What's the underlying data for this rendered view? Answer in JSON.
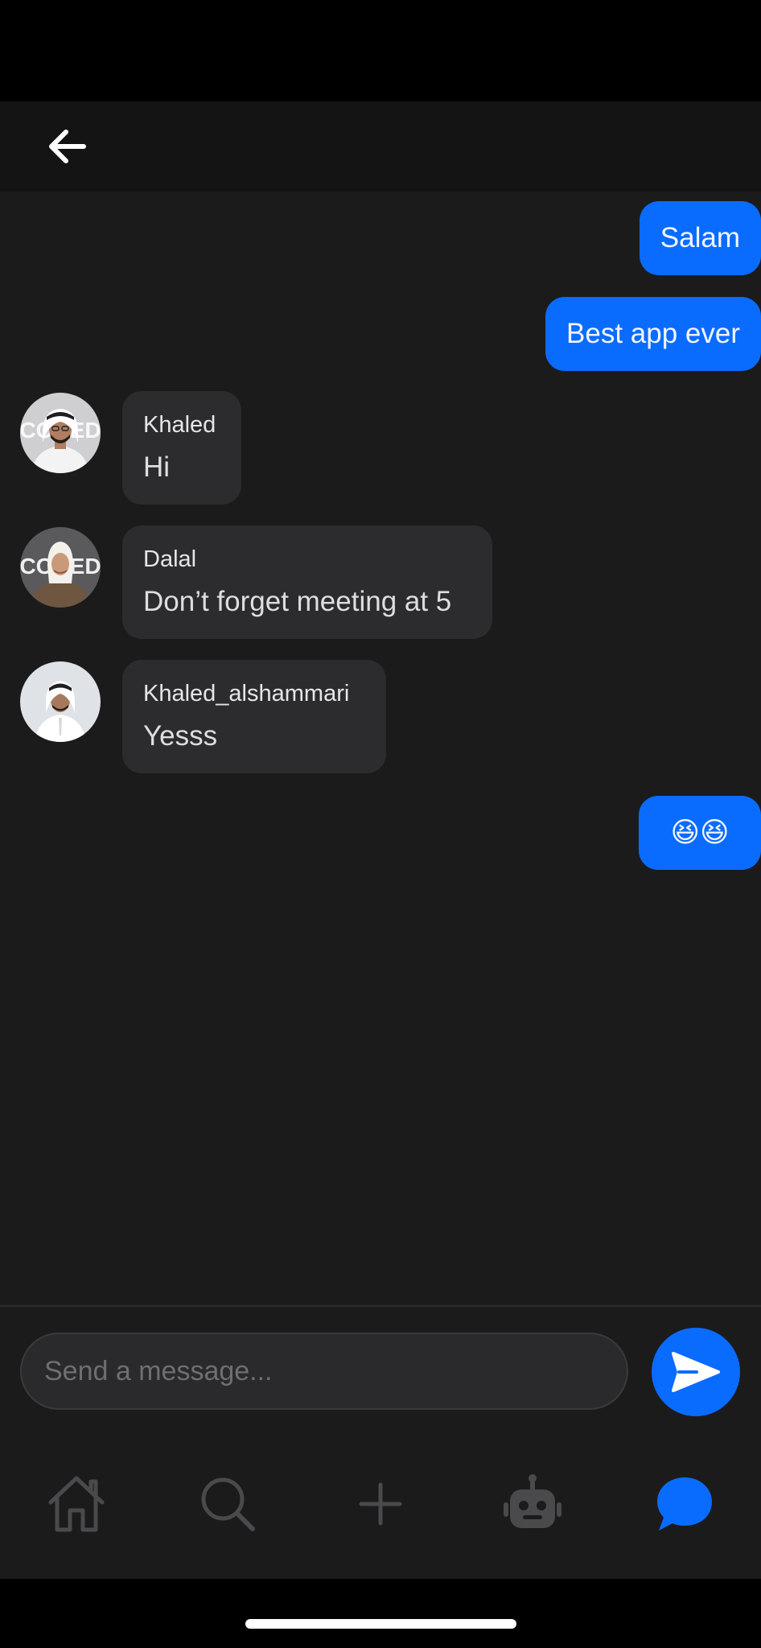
{
  "header": {
    "back_icon": "arrow-left-icon"
  },
  "messages": [
    {
      "direction": "outgoing",
      "text": "Salam"
    },
    {
      "direction": "outgoing",
      "text": "Best app ever"
    },
    {
      "direction": "incoming",
      "sender": "Khaled",
      "text": "Hi",
      "avatar_logo_text": "CODED"
    },
    {
      "direction": "incoming",
      "sender": "Dalal",
      "text": "Don’t forget meeting at 5",
      "avatar_logo_text": "CODED"
    },
    {
      "direction": "incoming",
      "sender": "Khaled_alshammari",
      "text": "Yesss"
    },
    {
      "direction": "outgoing",
      "text": "😆😆"
    }
  ],
  "composer": {
    "placeholder": "Send a message...",
    "send_icon": "send-icon"
  },
  "tabbar": {
    "items": [
      {
        "icon": "home-icon",
        "active": false
      },
      {
        "icon": "search-icon",
        "active": false
      },
      {
        "icon": "plus-icon",
        "active": false
      },
      {
        "icon": "robot-icon",
        "active": false
      },
      {
        "icon": "chat-bubble-icon",
        "active": true
      }
    ]
  },
  "colors": {
    "accent": "#0a6cff",
    "background": "#1b1b1c",
    "incoming_bubble": "#2c2c2e",
    "inactive_icon": "#4a4a4d"
  }
}
